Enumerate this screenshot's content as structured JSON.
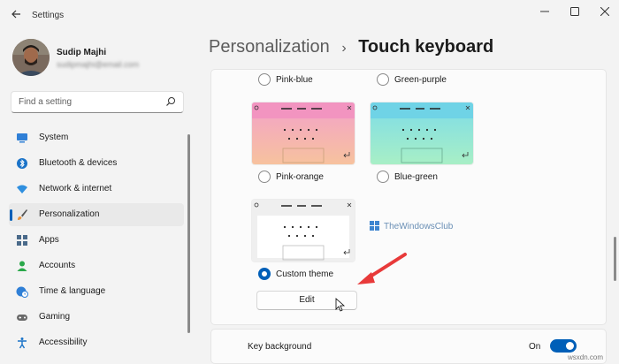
{
  "window": {
    "title": "Settings"
  },
  "profile": {
    "name": "Sudip Majhi",
    "email": "sudipmajhi@email.com"
  },
  "search": {
    "placeholder": "Find a setting"
  },
  "sidebar": {
    "items": [
      {
        "label": "System",
        "icon": "monitor-icon",
        "active": false
      },
      {
        "label": "Bluetooth & devices",
        "icon": "bluetooth-icon",
        "active": false
      },
      {
        "label": "Network & internet",
        "icon": "wifi-icon",
        "active": false
      },
      {
        "label": "Personalization",
        "icon": "brush-icon",
        "active": true
      },
      {
        "label": "Apps",
        "icon": "apps-icon",
        "active": false
      },
      {
        "label": "Accounts",
        "icon": "person-icon",
        "active": false
      },
      {
        "label": "Time & language",
        "icon": "globe-clock-icon",
        "active": false
      },
      {
        "label": "Gaming",
        "icon": "gamepad-icon",
        "active": false
      },
      {
        "label": "Accessibility",
        "icon": "accessibility-icon",
        "active": false
      }
    ]
  },
  "header": {
    "parent": "Personalization",
    "separator": "›",
    "current": "Touch keyboard"
  },
  "themes": {
    "pink_blue": "Pink-blue",
    "green_purple": "Green-purple",
    "pink_orange": "Pink-orange",
    "blue_green": "Blue-green",
    "custom": "Custom theme",
    "selected": "Custom theme"
  },
  "colors": {
    "accent": "#005fb8",
    "pink_orange_top": "#f4a6c9",
    "pink_orange_bottom": "#f7c3a0",
    "blue_green_top": "#7fdde8",
    "blue_green_bottom": "#a8f0c8",
    "arrow": "#e83a3a"
  },
  "edit": {
    "label": "Edit"
  },
  "watermark": {
    "text": "TheWindowsClub"
  },
  "key_background": {
    "label": "Key background",
    "state": "On"
  },
  "site": {
    "text": "wsxdn.com"
  }
}
